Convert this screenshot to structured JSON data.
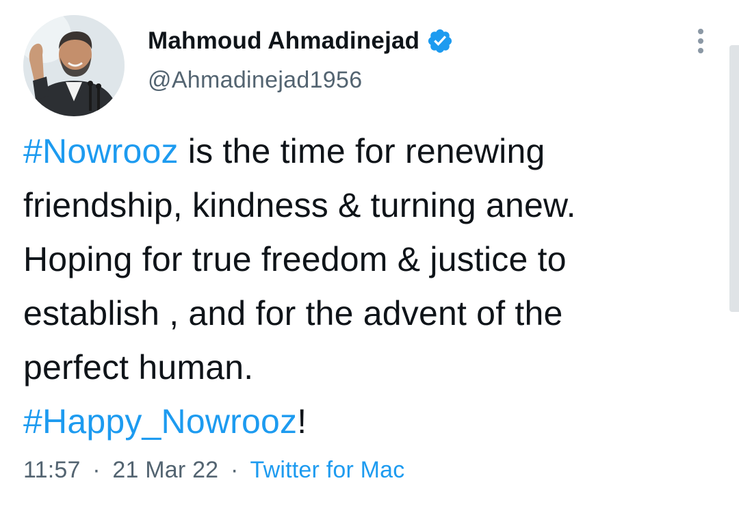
{
  "author": {
    "display_name": "Mahmoud Ahmadinejad",
    "handle": "@Ahmadinejad1956",
    "verified": true,
    "avatar_icon": "profile-photo",
    "verified_icon": "verified-badge-icon"
  },
  "menu": {
    "icon": "more-options-icon"
  },
  "tweet": {
    "lines": [
      [
        {
          "text": "#Nowrooz",
          "hashtag": true
        },
        {
          "text": " is the time for renewing",
          "hashtag": false
        }
      ],
      [
        {
          "text": "friendship, kindness & turning anew.",
          "hashtag": false
        }
      ],
      [
        {
          "text": "Hoping for true freedom & justice to",
          "hashtag": false
        }
      ],
      [
        {
          "text": "establish , and for the advent of the",
          "hashtag": false
        }
      ],
      [
        {
          "text": "perfect human.",
          "hashtag": false
        }
      ],
      [
        {
          "text": "#Happy_Nowrooz",
          "hashtag": true
        },
        {
          "text": "!",
          "hashtag": false
        }
      ]
    ]
  },
  "meta": {
    "time": "11:57",
    "separator": "·",
    "date": "21 Mar 22",
    "source": "Twitter for Mac"
  },
  "colors": {
    "link": "#1d9bf0",
    "text": "#0f1419",
    "secondary": "#536471",
    "background": "#ffffff"
  }
}
